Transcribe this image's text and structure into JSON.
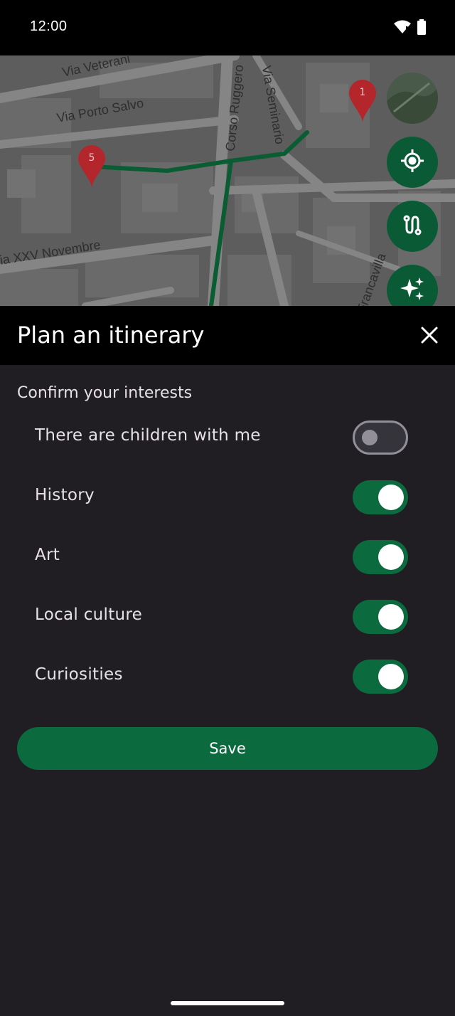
{
  "status_bar": {
    "time": "12:00",
    "icons": [
      "wifi-icon",
      "battery-icon"
    ]
  },
  "map": {
    "street_labels": [
      "Via Veterani",
      "Via Porto Salvo",
      "Corso Ruggero",
      "Via Seminario",
      "ia XXV Novembre",
      "Francavilla"
    ],
    "markers": [
      {
        "label": "1"
      },
      {
        "label": "5"
      }
    ],
    "route_color": "#0a5c33",
    "buttons": [
      "map-thumbnail",
      "my-location-icon",
      "route-icon",
      "sparkle-icon"
    ]
  },
  "sheet": {
    "title": "Plan an itinerary",
    "close_icon": "close-icon"
  },
  "interests": {
    "heading": "Confirm your interests",
    "items": [
      {
        "label": "There are children with me",
        "enabled": false
      },
      {
        "label": "History",
        "enabled": true
      },
      {
        "label": "Art",
        "enabled": true
      },
      {
        "label": "Local culture",
        "enabled": true
      },
      {
        "label": "Curiosities",
        "enabled": true
      }
    ]
  },
  "save_label": "Save",
  "colors": {
    "accent": "#0b6b3f",
    "background": "#201e22",
    "header": "#000000",
    "marker": "#b3262b"
  }
}
